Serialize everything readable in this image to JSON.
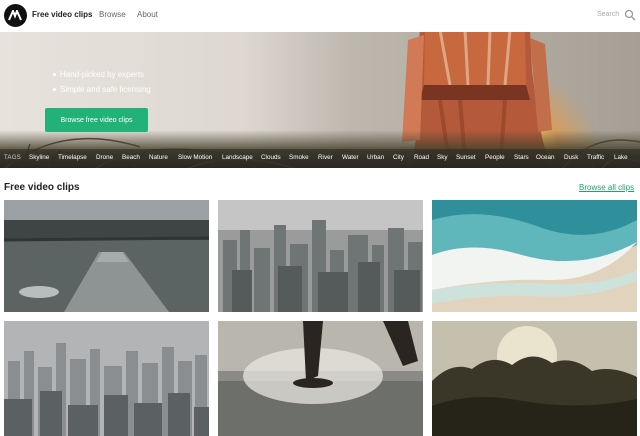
{
  "header": {
    "brand": "Free video clips",
    "nav": {
      "browse": "Browse",
      "about": "About"
    },
    "search_placeholder": "Search"
  },
  "hero": {
    "bullets": [
      "Hand-picked by experts",
      "Simple and safe licensing"
    ],
    "cta_label": "Browse free video clips"
  },
  "tags": {
    "label": "TAGS",
    "items": [
      "Skyline",
      "Timelapse",
      "Drone",
      "Beach",
      "Nature",
      "Slow Motion",
      "Landscape",
      "Clouds",
      "Smoke",
      "River",
      "Water",
      "Urban",
      "City",
      "Road",
      "Sky",
      "Sunset",
      "People",
      "Stars",
      "Ocean",
      "Dusk",
      "Traffic",
      "Lake"
    ]
  },
  "section": {
    "title": "Free video clips",
    "browse_all": "Browse all clips"
  },
  "clips": [
    {
      "subject": "lake-pier"
    },
    {
      "subject": "city-skyline-aerial"
    },
    {
      "subject": "ocean-waves-aerial"
    },
    {
      "subject": "city-skyline-haze"
    },
    {
      "subject": "water-splash-feet"
    },
    {
      "subject": "sunset-forest"
    }
  ],
  "colors": {
    "accent": "#22b278",
    "link": "#22a06b"
  }
}
